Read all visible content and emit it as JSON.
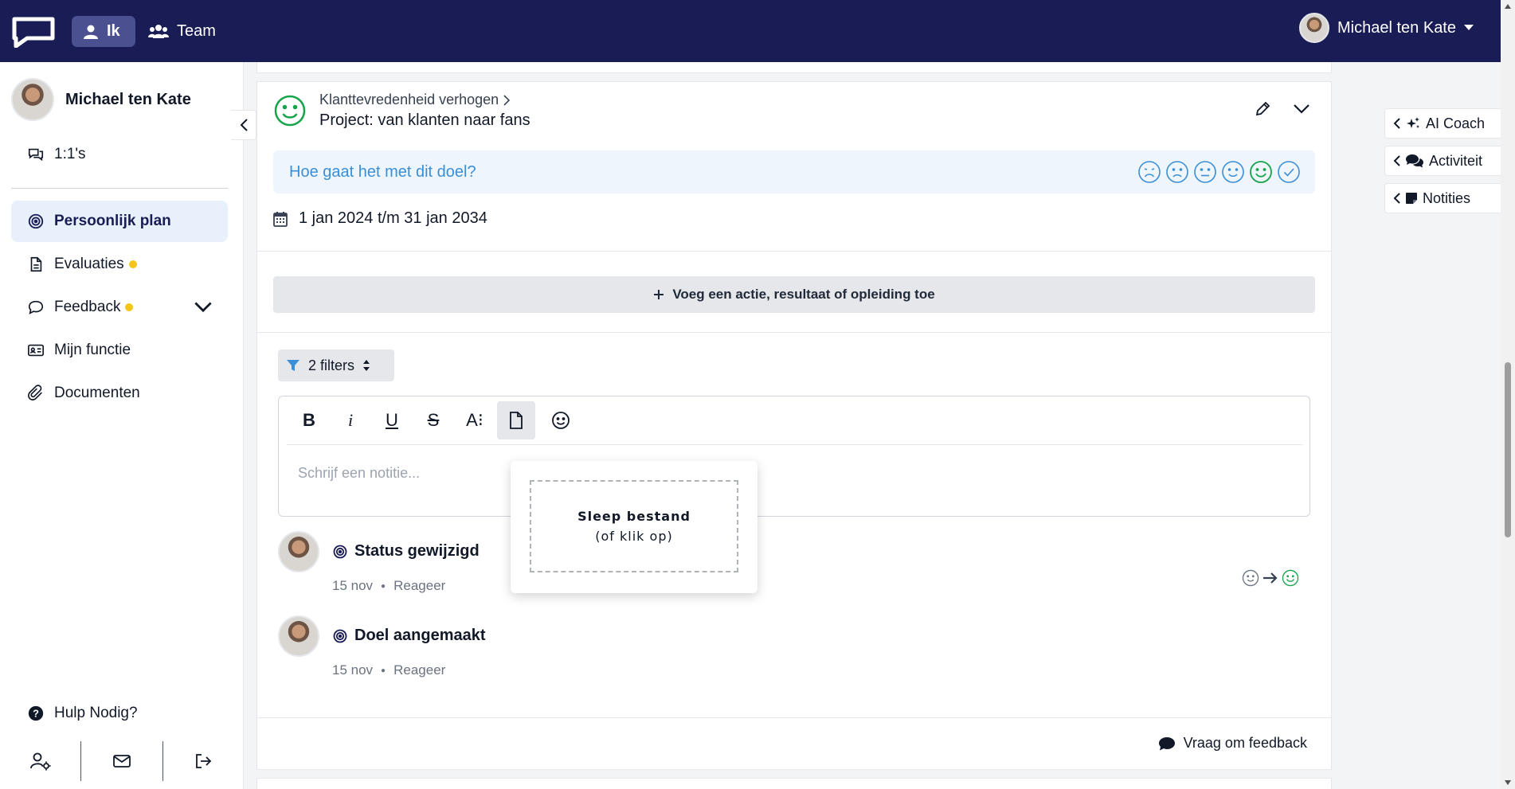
{
  "topbar": {
    "nav_ik": "Ik",
    "nav_team": "Team",
    "user_name": "Michael ten Kate"
  },
  "sidebar": {
    "user_name": "Michael ten Kate",
    "items": [
      {
        "label": "1:1's"
      },
      {
        "label": "Persoonlijk plan"
      },
      {
        "label": "Evaluaties"
      },
      {
        "label": "Feedback"
      },
      {
        "label": "Mijn functie"
      },
      {
        "label": "Documenten"
      }
    ],
    "help": "Hulp Nodig?"
  },
  "goal": {
    "breadcrumb": "Klanttevredenheid verhogen",
    "title": "Project: van klanten naar fans",
    "mood_question": "Hoe gaat het met dit doel?",
    "date_range": "1 jan 2024 t/m 31 jan 2034",
    "add_button": "Voeg een actie, resultaat of opleiding toe"
  },
  "filters": {
    "label": "2 filters"
  },
  "editor": {
    "placeholder": "Schrijf een notitie...",
    "toolbar": {
      "bold": "B",
      "italic": "i",
      "underline": "U",
      "strike": "S",
      "font_size": "A⁝"
    }
  },
  "upload_popup": {
    "title": "Sleep bestand",
    "subtitle": "(of klik op)"
  },
  "activities": [
    {
      "title": "Status gewijzigd",
      "date": "15 nov",
      "reply": "Reageer"
    },
    {
      "title": "Doel aangemaakt",
      "date": "15 nov",
      "reply": "Reageer"
    }
  ],
  "feedback_request": "Vraag om feedback",
  "right_tabs": [
    {
      "label": "AI Coach"
    },
    {
      "label": "Activiteit"
    },
    {
      "label": "Notities"
    }
  ],
  "colors": {
    "nav_bg": "#1a1d55",
    "accent_blue": "#3a8fd6",
    "mood_green": "#16a34a",
    "badge_yellow": "#f5c518"
  }
}
